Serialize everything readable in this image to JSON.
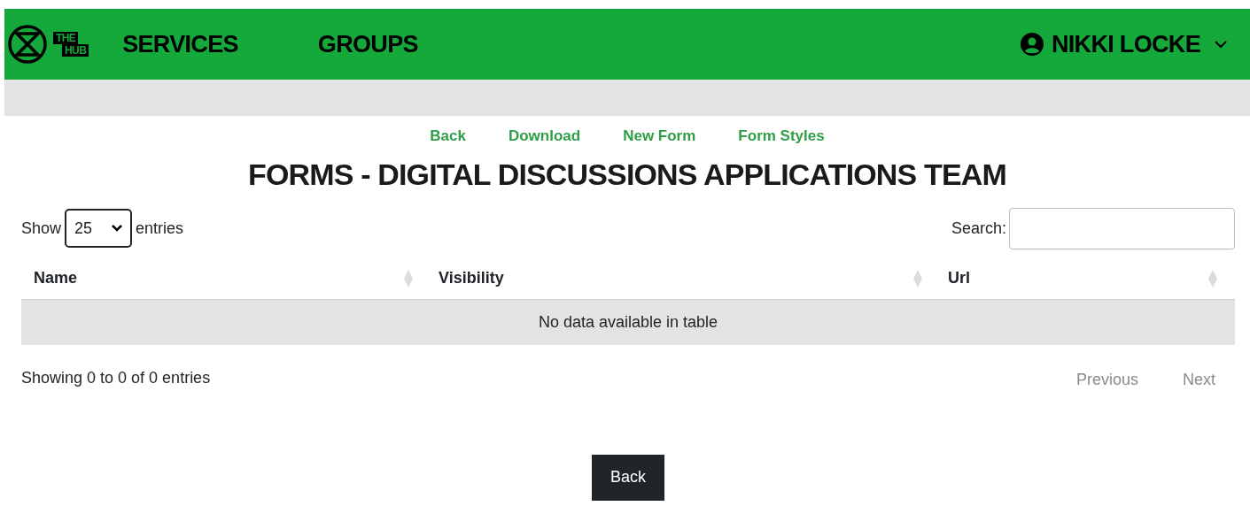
{
  "navbar": {
    "logo_text": [
      "THE",
      "HUB"
    ],
    "items": [
      {
        "label": "SERVICES"
      },
      {
        "label": "GROUPS"
      }
    ],
    "user": {
      "name": "NIKKI LOCKE"
    }
  },
  "links": [
    {
      "label": "Back"
    },
    {
      "label": "Download"
    },
    {
      "label": "New Form"
    },
    {
      "label": "Form Styles"
    }
  ],
  "title": "FORMS - DIGITAL DISCUSSIONS APPLICATIONS TEAM",
  "length_control": {
    "prefix": "Show",
    "value": "25",
    "suffix": "entries"
  },
  "search": {
    "label": "Search:"
  },
  "table": {
    "columns": [
      {
        "label": "Name"
      },
      {
        "label": "Visibility"
      },
      {
        "label": "Url"
      }
    ],
    "empty_message": "No data available in table"
  },
  "info": "Showing 0 to 0 of 0 entries",
  "pagination": [
    {
      "label": "Previous",
      "disabled": true
    },
    {
      "label": "Next",
      "disabled": true
    }
  ],
  "back_button": {
    "label": "Back"
  }
}
